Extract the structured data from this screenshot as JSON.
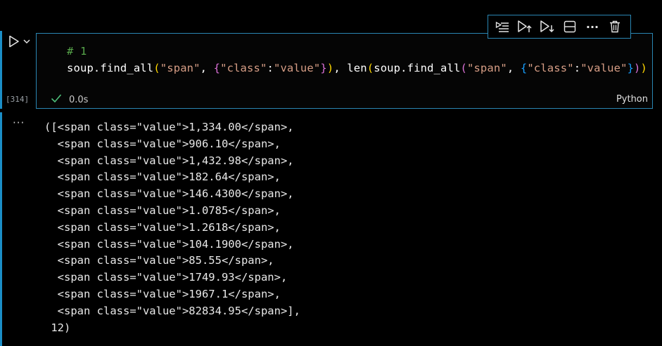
{
  "cell": {
    "execution_count": "[314]",
    "code": {
      "comment": "# 1",
      "line2": {
        "t1": "soup.find_all",
        "t2": "(",
        "t3": "\"span\"",
        "t4": ", ",
        "t5": "{",
        "t6": "\"class\"",
        "t7": ":",
        "t8": "\"value\"",
        "t9": "}",
        "t10": ")",
        "t11": ", len",
        "t12": "(",
        "t13": "soup.find_all",
        "t14": "(",
        "t15": "\"span\"",
        "t16": ", ",
        "t17": "{",
        "t18": "\"class\"",
        "t19": ":",
        "t20": "\"value\"",
        "t21": "}",
        "t22": ")",
        "t23": ")"
      }
    },
    "status": {
      "duration": "0.0s",
      "success_color": "#4ec07a"
    },
    "language": "Python"
  },
  "toolbar": {
    "icons": [
      "run-by-line-icon",
      "execute-above-icon",
      "execute-below-icon",
      "split-cell-icon",
      "more-icon",
      "delete-icon"
    ],
    "more_glyph": "···"
  },
  "output": {
    "ellipsis": "···",
    "lines": [
      "([<span class=\"value\">1,334.00</span>,",
      "  <span class=\"value\">906.10</span>,",
      "  <span class=\"value\">1,432.98</span>,",
      "  <span class=\"value\">182.64</span>,",
      "  <span class=\"value\">146.4300</span>,",
      "  <span class=\"value\">1.0785</span>,",
      "  <span class=\"value\">1.2618</span>,",
      "  <span class=\"value\">104.1900</span>,",
      "  <span class=\"value\">85.55</span>,",
      "  <span class=\"value\">1749.93</span>,",
      "  <span class=\"value\">1967.1</span>,",
      "  <span class=\"value\">82834.95</span>],",
      " 12)"
    ]
  },
  "colors": {
    "accent": "#2a86b3",
    "background": "#000000",
    "comment": "#57a64a",
    "string": "#d69d85"
  }
}
